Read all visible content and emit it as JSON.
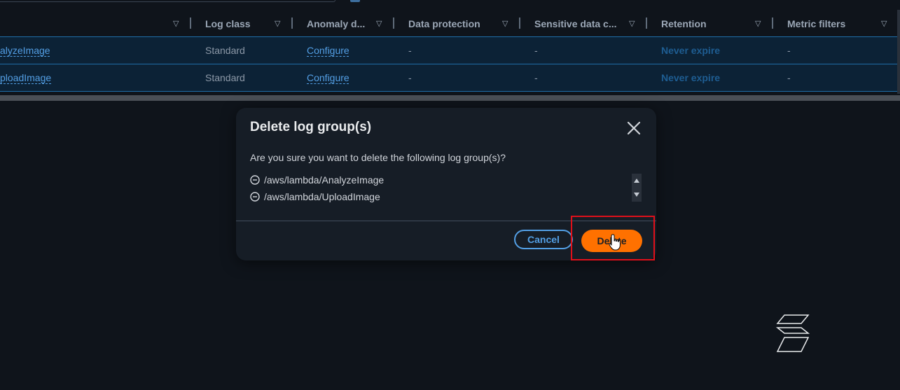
{
  "table": {
    "columns": [
      {
        "label": ""
      },
      {
        "label": "Log class"
      },
      {
        "label": "Anomaly d..."
      },
      {
        "label": "Data protection"
      },
      {
        "label": "Sensitive data c..."
      },
      {
        "label": "Retention"
      },
      {
        "label": "Metric filters"
      }
    ],
    "sort_glyph": "▽",
    "rows": [
      {
        "name": "alyzeImage",
        "log_class": "Standard",
        "anomaly": "Configure",
        "data_protection": "-",
        "sensitive": "-",
        "retention": "Never expire",
        "metric_filters": "-"
      },
      {
        "name": "ploadImage",
        "log_class": "Standard",
        "anomaly": "Configure",
        "data_protection": "-",
        "sensitive": "-",
        "retention": "Never expire",
        "metric_filters": "-"
      }
    ]
  },
  "modal": {
    "title": "Delete log group(s)",
    "question": "Are you sure you want to delete the following log group(s)?",
    "items": [
      "/aws/lambda/AnalyzeImage",
      "/aws/lambda/UploadImage"
    ],
    "cancel_label": "Cancel",
    "delete_label": "Delete"
  },
  "colors": {
    "accent_blue": "#539fe5",
    "delete_orange": "#ff7100",
    "highlight_red": "#e0101a",
    "background": "#0f141b"
  },
  "icons": {
    "close": "close-icon",
    "item": "minus-circle-icon",
    "cursor": "hand-pointer-icon"
  }
}
